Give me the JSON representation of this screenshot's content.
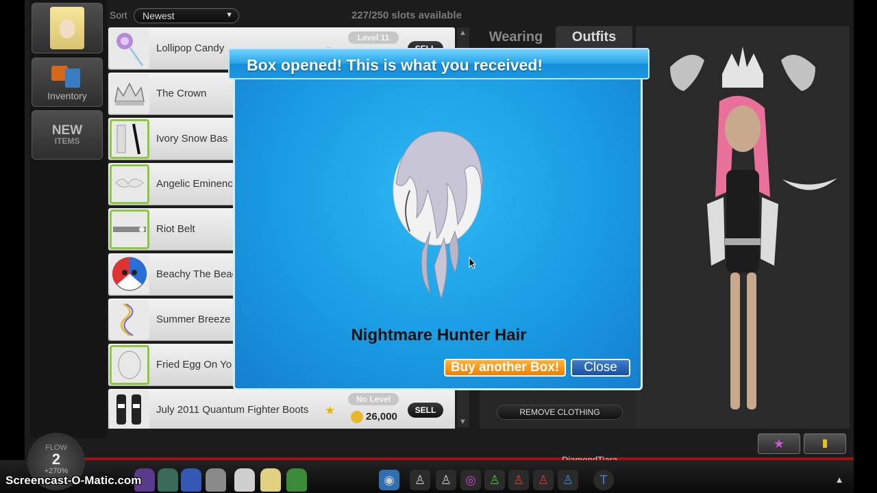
{
  "nav": {
    "inventory_label": "Inventory",
    "new_items_line1": "NEW",
    "new_items_line2": "ITEMS"
  },
  "sort": {
    "label": "Sort",
    "selected": "Newest",
    "arrow": "▼"
  },
  "slots_text": "227/250 slots available",
  "items": [
    {
      "name": "Lollipop Candy",
      "level": "Level 11",
      "sell": "SELL"
    },
    {
      "name": "The Crown"
    },
    {
      "name": "Ivory Snow Bas"
    },
    {
      "name": "Angelic Eminenc"
    },
    {
      "name": "Riot Belt"
    },
    {
      "name": "Beachy The Beac"
    },
    {
      "name": "Summer Breeze"
    },
    {
      "name": "Fried Egg On Yo"
    },
    {
      "name": "July 2011 Quantum Fighter Boots",
      "level": "No Level",
      "price": "26,000",
      "sell": "SELL"
    }
  ],
  "tabs": {
    "wearing": "Wearing",
    "outfits": "Outfits"
  },
  "remove_clothing": "REMOVE CLOTHING",
  "modal": {
    "title": "Box opened! This is what you received!",
    "item_name": "Nightmare Hunter Hair",
    "buy_label": "Buy another Box!",
    "close_label": "Close"
  },
  "flow": {
    "title": "FLOW",
    "number": "2",
    "percent": "+270%"
  },
  "username": "DiamondTiara",
  "watermark": "Screencast-O-Matic.com",
  "colors": {
    "modal_blue": "#1a9ce3",
    "buy_orange": "#f07f00",
    "close_blue": "#1b4f9e"
  }
}
